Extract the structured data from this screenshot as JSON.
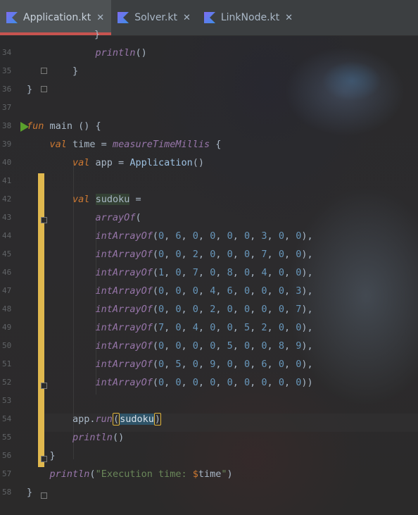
{
  "tabs": [
    {
      "label": "Application.kt",
      "active": true
    },
    {
      "label": "Solver.kt",
      "active": false
    },
    {
      "label": "LinkNode.kt",
      "active": false
    }
  ],
  "colors": {
    "keyword": "#cc7832",
    "number": "#6897bb",
    "string": "#6a8759",
    "function": "#9876aa",
    "change_marker": "#e0b84e",
    "run_icon": "#5aa02c",
    "active_tab_underline": "#c75450"
  },
  "editor": {
    "lines": [
      {
        "no": "34",
        "text": "            println()"
      },
      {
        "no": "35",
        "text": "        }"
      },
      {
        "no": "36",
        "text": "}"
      },
      {
        "no": "37",
        "text": ""
      },
      {
        "no": "38",
        "text": "fun main () {"
      },
      {
        "no": "39",
        "text": "    val time = measureTimeMillis {"
      },
      {
        "no": "40",
        "text": "        val app = Application()"
      },
      {
        "no": "41",
        "text": ""
      },
      {
        "no": "42",
        "text": "        val sudoku ="
      },
      {
        "no": "43",
        "text": "            arrayOf("
      },
      {
        "no": "44",
        "text": "            intArrayOf(0, 6, 0, 0, 0, 0, 3, 0, 0),"
      },
      {
        "no": "45",
        "text": "            intArrayOf(0, 0, 2, 0, 0, 0, 7, 0, 0),"
      },
      {
        "no": "46",
        "text": "            intArrayOf(1, 0, 7, 0, 8, 0, 4, 0, 0),"
      },
      {
        "no": "47",
        "text": "            intArrayOf(0, 0, 0, 4, 6, 0, 0, 0, 3),"
      },
      {
        "no": "48",
        "text": "            intArrayOf(0, 0, 0, 2, 0, 0, 0, 0, 7),"
      },
      {
        "no": "49",
        "text": "            intArrayOf(7, 0, 4, 0, 0, 5, 2, 0, 0),"
      },
      {
        "no": "50",
        "text": "            intArrayOf(0, 0, 0, 0, 5, 0, 0, 8, 9),"
      },
      {
        "no": "51",
        "text": "            intArrayOf(0, 5, 0, 9, 0, 0, 6, 0, 0),"
      },
      {
        "no": "52",
        "text": "            intArrayOf(0, 0, 0, 0, 0, 0, 0, 0, 0))"
      },
      {
        "no": "53",
        "text": ""
      },
      {
        "no": "54",
        "text": "        app.run(sudoku)"
      },
      {
        "no": "55",
        "text": "        println()"
      },
      {
        "no": "56",
        "text": "    }"
      },
      {
        "no": "57",
        "text": "    println(\"Execution time: $time\")"
      },
      {
        "no": "58",
        "text": "}"
      }
    ],
    "top_partial_line": "}"
  }
}
